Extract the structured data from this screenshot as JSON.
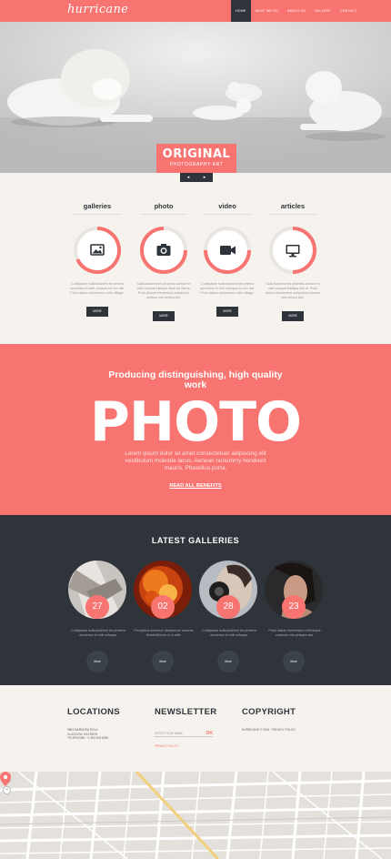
{
  "header": {
    "logo": "hurricane",
    "nav": [
      {
        "label": "Home",
        "active": true
      },
      {
        "label": "What we do",
        "active": false
      },
      {
        "label": "About us",
        "active": false
      },
      {
        "label": "Gallery",
        "active": false
      },
      {
        "label": "Contact",
        "active": false
      }
    ]
  },
  "hero": {
    "title": "ORIGINAL",
    "subtitle": "PHOTOGRAPHY ART",
    "prev": "◂",
    "next": "▸"
  },
  "features": [
    {
      "title": "galleries",
      "icon": "image-icon",
      "text": "Cubilyande sollicitudinred les phrera aumentus in velit voluqua ero leo nisi. Proin dictum elementum odio vittage.",
      "button": "More"
    },
    {
      "title": "photo",
      "icon": "camera-icon",
      "text": "Sollicitudinred les pharetra aumore in velit voluqua tristique diam for nisi at. Proin dictum elementum antiplution sciebue sita pelqea sita.",
      "button": "More"
    },
    {
      "title": "video",
      "icon": "video-camera-icon",
      "text": "Cubilyande sollicitudinred les phrera aumentus in velit voluqua ero leo nisi. Proin dictum elementum odio vittage.",
      "button": "More"
    },
    {
      "title": "articles",
      "icon": "monitor-icon",
      "text": "Sollicitudinred les pharetra aumore in velit voluqua tristique nisi at. Proin dictum elementum antiplution sciebue sita pelqea sita.",
      "button": "More"
    }
  ],
  "banner": {
    "headline": "Producing distinguishing, high quality work",
    "big": "PHOTO",
    "body": "Lorem ipsum dolor sit amet consectetuer adipiscing elit vestibulum molestie lacus. Aenean nonummy hendrerit mauris. Phasellus porta.",
    "link": "READ ALL BENEFITS"
  },
  "galleries": {
    "title": "LATEST GALLERIES",
    "items": [
      {
        "date": "27",
        "text": "Cubilyande sollicitudinred les pharera aumentus in velit voluqua.",
        "button": "More"
      },
      {
        "date": "02",
        "text": "Proldplbus scelecue vitaeprecon maxime fermentDones in in velit.",
        "button": "More"
      },
      {
        "date": "28",
        "text": "Cubilyande sollicitudinred les pharera aumentus in velit voluqua.",
        "button": "More"
      },
      {
        "date": "23",
        "text": "Proin dictum elementum velit ldrqua scelecue vita pelsqea sita.",
        "button": "More"
      }
    ]
  },
  "footer": {
    "locations": {
      "title": "LOCATIONS",
      "lines": [
        "9863 MARDDRA ROLA",
        "GLASGOW, D04 89GR",
        "TELEPHONE: +1 800 603 6035"
      ]
    },
    "newsletter": {
      "title": "NEWSLETTER",
      "placeholder": "ENTER YOUR EMAIL",
      "submit": "OK",
      "policy": "PRIVACY POLICY"
    },
    "copyright": {
      "title": "COPYRIGHT",
      "line": "HURRICANE © 2015 · PRIVACY POLICY"
    }
  },
  "map": {
    "zoom_in": "+",
    "zoom_out": "−"
  },
  "colors": {
    "accent": "#f77471",
    "dark": "#2f343a",
    "light": "#f6f3ef"
  }
}
